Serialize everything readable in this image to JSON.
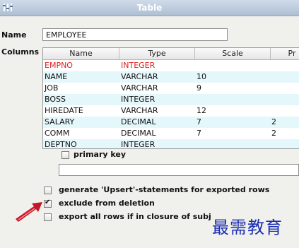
{
  "window": {
    "title": "Table"
  },
  "form": {
    "name_label": "Name",
    "name_value": "EMPLOYEE",
    "columns_label": "Columns"
  },
  "table": {
    "headers": [
      "Name",
      "Type",
      "Scale",
      "Pr"
    ],
    "rows": [
      {
        "name": "EMPNO",
        "type": "INTEGER",
        "scale": "",
        "pr": "",
        "primary_key": true
      },
      {
        "name": "NAME",
        "type": "VARCHAR",
        "scale": "10",
        "pr": ""
      },
      {
        "name": "JOB",
        "type": "VARCHAR",
        "scale": "9",
        "pr": ""
      },
      {
        "name": "BOSS",
        "type": "INTEGER",
        "scale": "",
        "pr": ""
      },
      {
        "name": "HIREDATE",
        "type": "VARCHAR",
        "scale": "12",
        "pr": ""
      },
      {
        "name": "SALARY",
        "type": "DECIMAL",
        "scale": "7",
        "pr": "2"
      },
      {
        "name": "COMM",
        "type": "DECIMAL",
        "scale": "7",
        "pr": "2"
      },
      {
        "name": "DEPTNO",
        "type": "INTEGER",
        "scale": "",
        "pr": ""
      }
    ]
  },
  "options": {
    "primary_key": {
      "label": "primary key",
      "checked": false
    },
    "generate_upsert": {
      "label": "generate 'Upsert'-statements for exported rows",
      "checked": false
    },
    "exclude_deletion": {
      "label": "exclude from deletion",
      "checked": true
    },
    "export_all_rows": {
      "label": "export all rows if in closure of subj",
      "checked": false
    }
  },
  "watermark": "最需教育",
  "colors": {
    "primary_key_text": "#e02020",
    "alt_row": "#e4f7fb",
    "watermark": "#1c2fb0",
    "arrow": "#c4162a"
  }
}
